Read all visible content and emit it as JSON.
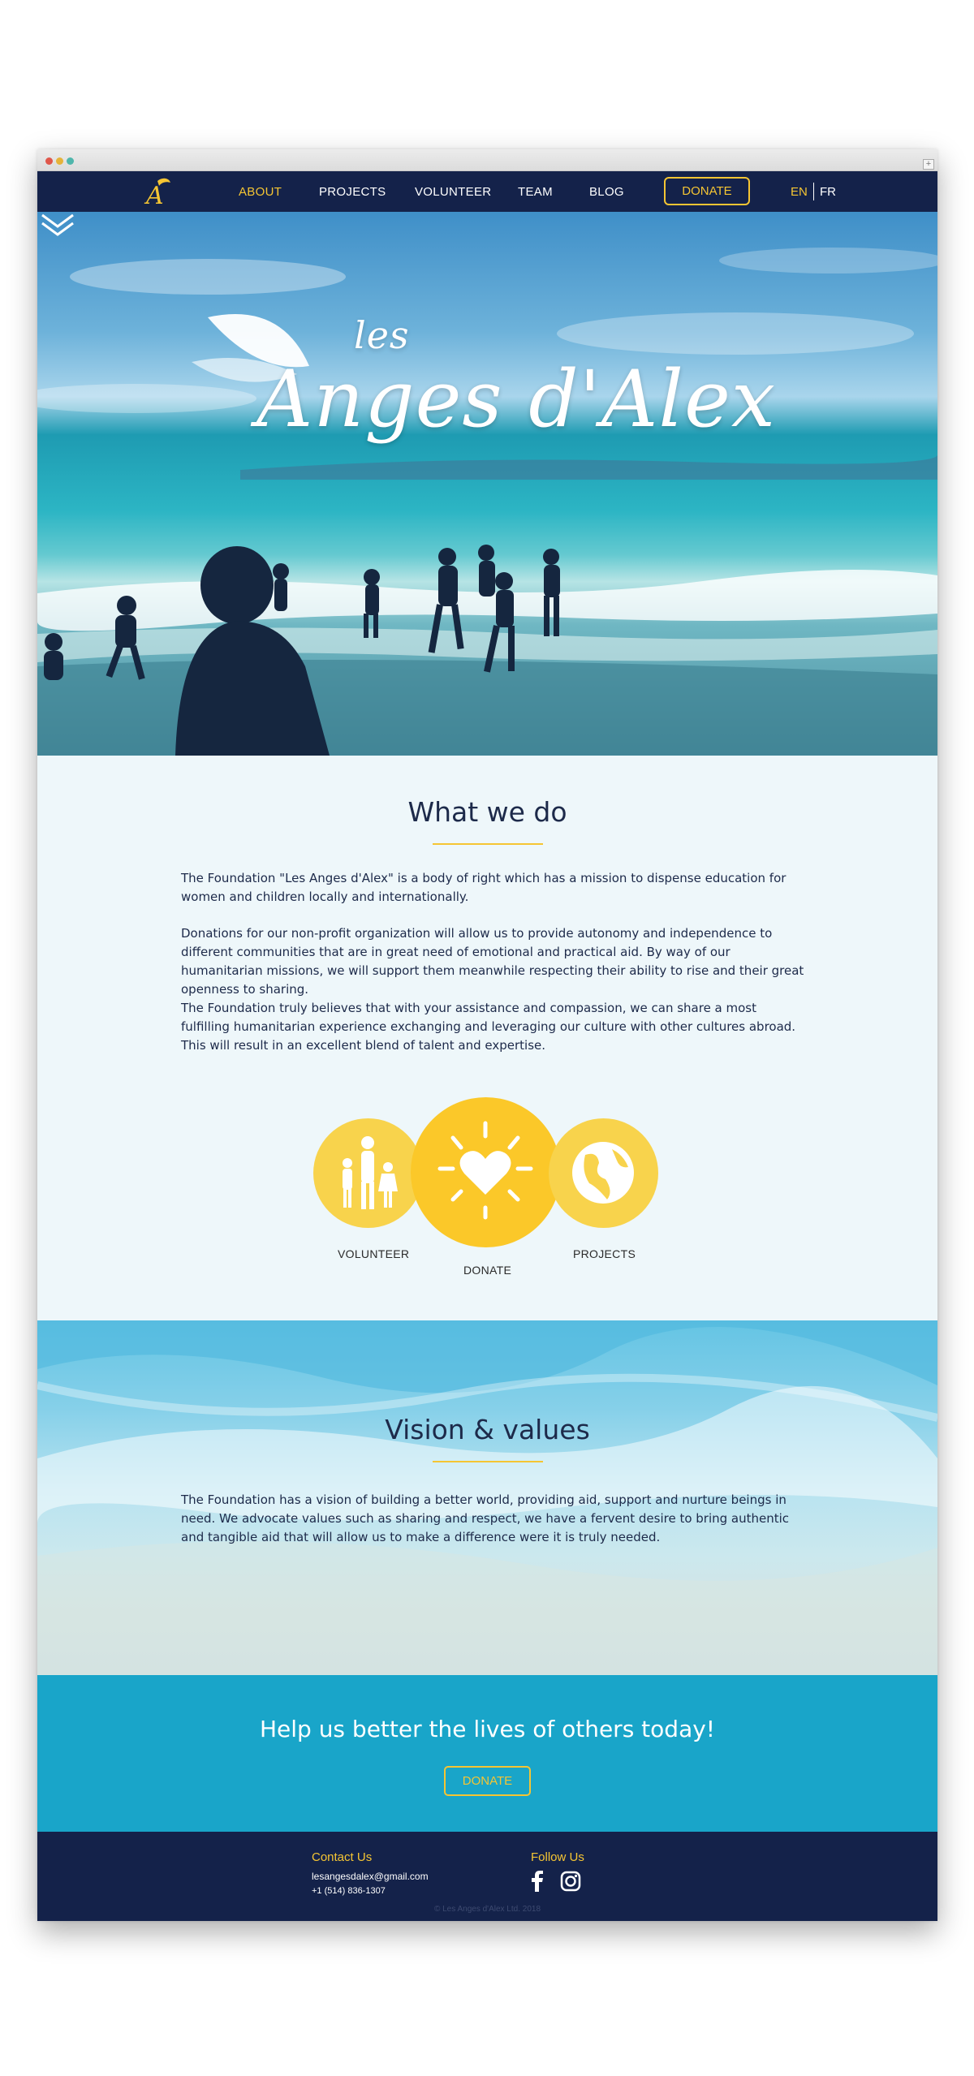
{
  "nav": {
    "items": [
      "ABOUT",
      "PROJECTS",
      "VOLUNTEER",
      "TEAM",
      "BLOG"
    ],
    "active": "ABOUT",
    "donate_label": "DONATE",
    "lang_en": "EN",
    "lang_fr": "FR"
  },
  "hero": {
    "title_small": "les",
    "title_main": "Anges d'Alex"
  },
  "what_we_do": {
    "title": "What we do",
    "paragraphs": [
      "The Foundation \"Les Anges d'Alex\" is a body of right which has a mission to dispense education for women and children locally and internationally.",
      "Donations for our non-profit organization will allow us to provide autonomy and independence to different communities that  are in great need of emotional and practical aid. By way of our humanitarian missions, we will support them meanwhile respecting their ability to rise and their great openness to sharing.",
      "The Foundation truly believes that with your assistance and compassion, we can share a most fulfilling humanitarian experience exchanging and leveraging our culture with other cultures abroad.  This will result in an excellent blend of talent and expertise."
    ],
    "circles": {
      "volunteer": "VOLUNTEER",
      "donate": "DONATE",
      "projects": "PROJECTS"
    }
  },
  "vision": {
    "title": "Vision & values",
    "text": "The Foundation has a vision of building a better world, providing aid, support and nurture beings in need. We advocate values such as sharing and respect, we have a fervent desire to bring authentic and tangible aid that will allow us to make a difference were it is truly needed."
  },
  "cta": {
    "title": "Help us better the lives of others today!",
    "button": "DONATE"
  },
  "footer": {
    "contact_title": "Contact Us",
    "email": "lesangesdalex@gmail.com",
    "phone": "+1 (514) 836-1307",
    "follow_title": "Follow Us",
    "copyright": "© Les Anges d'Alex Ltd. 2018"
  },
  "colors": {
    "navy": "#14224a",
    "gold": "#f5c533",
    "cta_blue": "#19a5c9",
    "light_bg": "#eef7fa"
  },
  "icons": [
    "facebook-icon",
    "instagram-icon",
    "family-icon",
    "heart-sun-icon",
    "globe-icon",
    "chevron-down-icon",
    "angel-logo-icon"
  ]
}
